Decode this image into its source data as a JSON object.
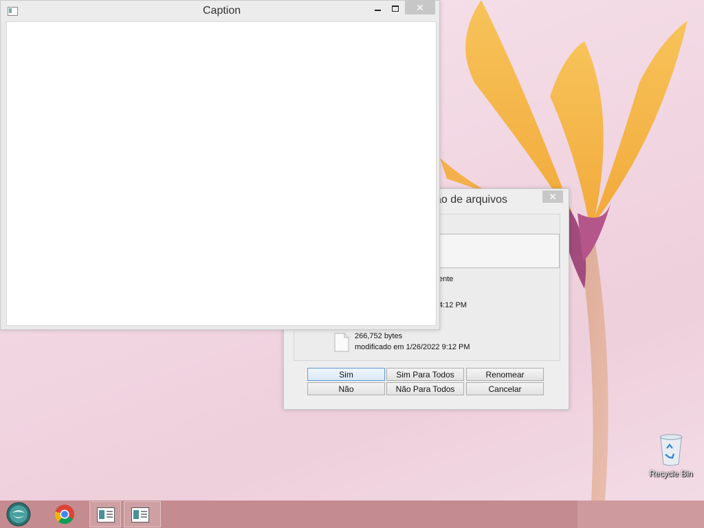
{
  "caption_window": {
    "title": "Caption"
  },
  "confirm_dialog": {
    "title": "ão de arquivos",
    "close_glyph": "✕",
    "existing_file_fragment": "ente",
    "existing_file_time_fragment": "4:12 PM",
    "new_file": {
      "size": "266,752 bytes",
      "modified": "modificado em 1/26/2022 9:12 PM"
    },
    "buttons": {
      "yes": "Sim",
      "yes_to_all": "Sim Para Todos",
      "rename": "Renomear",
      "no": "Não",
      "no_to_all": "Não Para Todos",
      "cancel": "Cancelar"
    }
  },
  "desktop": {
    "recycle_bin_label": "Recycle Bin"
  },
  "colors": {
    "accent_default_button": "#5b9ad6",
    "taskbar": "#c48b90"
  },
  "taskbar": {
    "items": [
      "start-orb-icon",
      "chrome-icon",
      "window-app-icon",
      "window-app-icon"
    ]
  }
}
